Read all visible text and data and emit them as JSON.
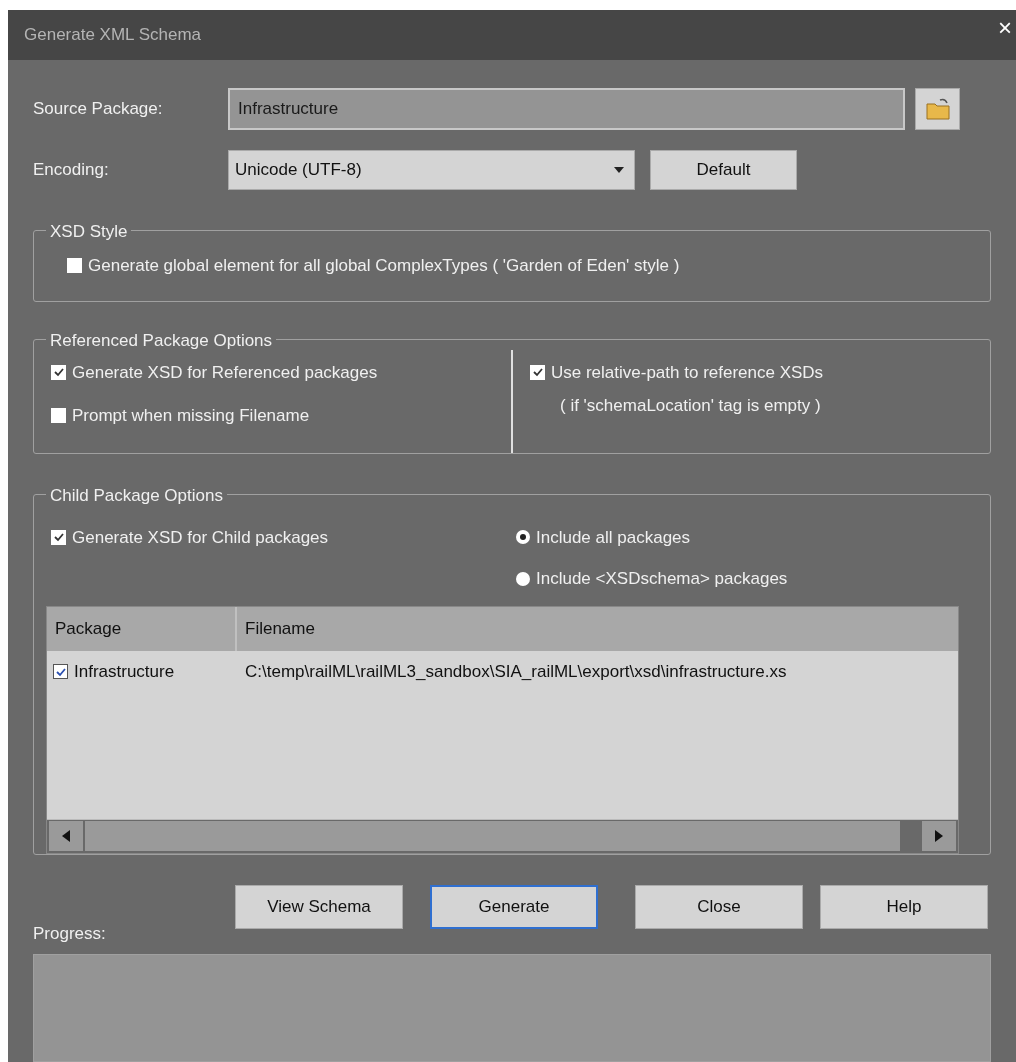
{
  "window": {
    "title": "Generate XML Schema",
    "close": "×"
  },
  "source_package": {
    "label": "Source Package:",
    "value": "Infrastructure"
  },
  "encoding": {
    "label": "Encoding:",
    "value": "Unicode (UTF-8)",
    "default_button": "Default"
  },
  "xsd_style": {
    "title": "XSD Style",
    "options": [
      {
        "label": "Generate global element for all global ComplexTypes ( 'Garden of Eden' style )",
        "checked": false
      }
    ]
  },
  "referenced": {
    "title": "Referenced Package Options",
    "left": [
      {
        "label": "Generate XSD for Referenced packages",
        "checked": true
      },
      {
        "label": "Prompt when missing Filename",
        "checked": false
      }
    ],
    "right": [
      {
        "label": "Use relative-path to reference XSDs",
        "note": "( if 'schemaLocation' tag is empty )",
        "checked": true
      }
    ]
  },
  "child": {
    "title": "Child Package Options",
    "option": {
      "label": "Generate XSD for Child packages",
      "checked": true
    },
    "radios": [
      {
        "label": "Include all packages",
        "selected": true
      },
      {
        "label": "Include <XSDschema> packages",
        "selected": false
      }
    ],
    "table": {
      "columns": [
        "Package",
        "Filename"
      ],
      "rows": [
        {
          "checked": true,
          "package": "Infrastructure",
          "filename": "C:\\temp\\railML\\railML3_sandbox\\SIA_railML\\export\\xsd\\infrastructure.xs"
        }
      ]
    }
  },
  "buttons": [
    {
      "label": "View Schema",
      "focused": false
    },
    {
      "label": "Generate",
      "focused": true
    },
    {
      "label": "Close",
      "focused": false
    },
    {
      "label": "Help",
      "focused": false
    }
  ],
  "progress": {
    "label": "Progress:"
  }
}
